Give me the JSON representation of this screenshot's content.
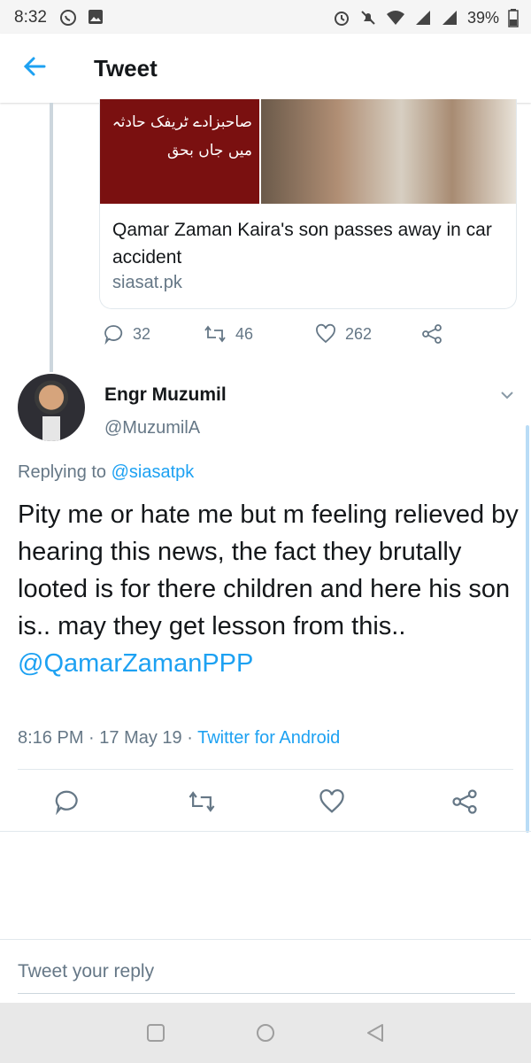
{
  "status_bar": {
    "time": "8:32",
    "battery": "39%"
  },
  "app_bar": {
    "back_icon": "arrow-left-icon",
    "title": "Tweet"
  },
  "quoted_card": {
    "image_caption_urdu_line1": "صاحبزادے ٹریفک حادثہ",
    "image_caption_urdu_line2": "میں جاں بحق",
    "headline": "Qamar Zaman Kaira's son passes away in car accident",
    "domain": "siasat.pk"
  },
  "parent_actions": {
    "replies": "32",
    "retweets": "46",
    "likes": "262"
  },
  "tweet": {
    "author_name": "Engr Muzumil",
    "author_handle": "@MuzumilA",
    "replying_prefix": "Replying to",
    "replying_handle": "@siasatpk",
    "text": "Pity me or hate me but m feeling relieved by hearing this news, the fact they brutally looted is for there children and here his son is.. may they get lesson from this..",
    "mention": "@QamarZamanPPP",
    "time": "8:16 PM",
    "date": "17 May 19",
    "source": "Twitter for Android"
  },
  "reply_box": {
    "placeholder": "Tweet your reply"
  },
  "colors": {
    "accent": "#1da1f2",
    "secondary_text": "#657786",
    "primary_text": "#14171a"
  }
}
